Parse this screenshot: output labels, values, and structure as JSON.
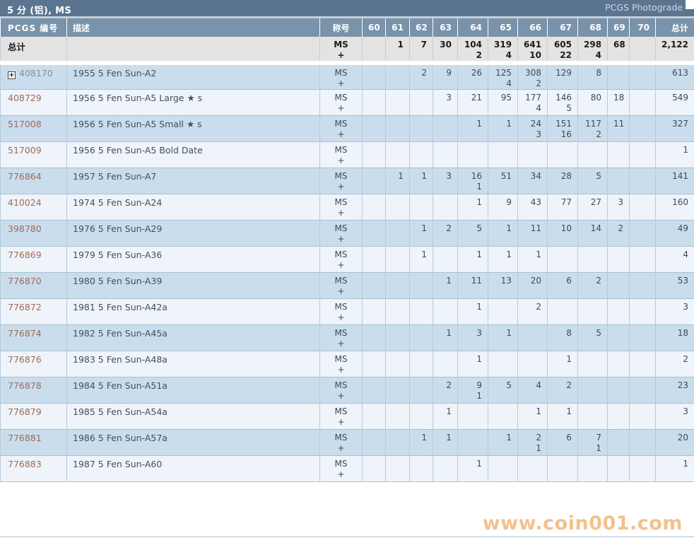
{
  "header": {
    "title": "5 分 (铝), MS",
    "photograde_link": "PCGS Photograde"
  },
  "icons": {
    "expand_glyph": "+"
  },
  "watermark": "www.coin001.com",
  "colors": {
    "title_bar": "#5b7490",
    "header_row": "#7893aa",
    "row_blue": "#cadded",
    "row_pale": "#eef4f9",
    "totals_bg": "#e3e3e3",
    "link": "#9c6a59",
    "visited_link": "#8d8d8d",
    "watermark": "#f2a960"
  },
  "table": {
    "columns": [
      "PCGS 编号",
      "描述",
      "称号",
      "60",
      "61",
      "62",
      "63",
      "64",
      "65",
      "66",
      "67",
      "68",
      "69",
      "70",
      "总计"
    ],
    "designation": {
      "line1": "MS",
      "line2": "+"
    },
    "totals": {
      "label": "总计",
      "grades": [
        [
          "",
          ""
        ],
        [
          "1",
          ""
        ],
        [
          "7",
          ""
        ],
        [
          "30",
          ""
        ],
        [
          "104",
          "2"
        ],
        [
          "319",
          "4"
        ],
        [
          "641",
          "10"
        ],
        [
          "605",
          "22"
        ],
        [
          "298",
          "4"
        ],
        [
          "68",
          ""
        ],
        [
          "",
          ""
        ]
      ],
      "total": "2,122"
    },
    "rows": [
      {
        "pcgs": "408170",
        "expandable": true,
        "visited": true,
        "desc": "1955 5 Fen Sun-A2",
        "grades": [
          [
            "",
            ""
          ],
          [
            "",
            ""
          ],
          [
            "2",
            ""
          ],
          [
            "9",
            ""
          ],
          [
            "26",
            ""
          ],
          [
            "125",
            "4"
          ],
          [
            "308",
            "2"
          ],
          [
            "129",
            ""
          ],
          [
            "8",
            ""
          ],
          [
            "",
            ""
          ],
          [
            "",
            ""
          ]
        ],
        "total": "613"
      },
      {
        "pcgs": "408729",
        "desc": "1956 5 Fen Sun-A5 Large ★ s",
        "grades": [
          [
            "",
            ""
          ],
          [
            "",
            ""
          ],
          [
            "",
            ""
          ],
          [
            "3",
            ""
          ],
          [
            "21",
            ""
          ],
          [
            "95",
            ""
          ],
          [
            "177",
            "4"
          ],
          [
            "146",
            "5"
          ],
          [
            "80",
            ""
          ],
          [
            "18",
            ""
          ],
          [
            "",
            ""
          ]
        ],
        "total": "549"
      },
      {
        "pcgs": "517008",
        "desc": "1956 5 Fen Sun-A5 Small ★ s",
        "grades": [
          [
            "",
            ""
          ],
          [
            "",
            ""
          ],
          [
            "",
            ""
          ],
          [
            "",
            ""
          ],
          [
            "1",
            ""
          ],
          [
            "1",
            ""
          ],
          [
            "24",
            "3"
          ],
          [
            "151",
            "16"
          ],
          [
            "117",
            "2"
          ],
          [
            "11",
            ""
          ],
          [
            "",
            ""
          ]
        ],
        "total": "327"
      },
      {
        "pcgs": "517009",
        "desc": "1956 5 Fen Sun-A5 Bold Date",
        "grades": [
          [
            "",
            ""
          ],
          [
            "",
            ""
          ],
          [
            "",
            ""
          ],
          [
            "",
            ""
          ],
          [
            "",
            ""
          ],
          [
            "",
            ""
          ],
          [
            "",
            ""
          ],
          [
            "",
            ""
          ],
          [
            "",
            ""
          ],
          [
            "",
            ""
          ],
          [
            "",
            ""
          ]
        ],
        "total": "1"
      },
      {
        "pcgs": "776864",
        "desc": "1957 5 Fen Sun-A7",
        "grades": [
          [
            "",
            ""
          ],
          [
            "1",
            ""
          ],
          [
            "1",
            ""
          ],
          [
            "3",
            ""
          ],
          [
            "16",
            "1"
          ],
          [
            "51",
            ""
          ],
          [
            "34",
            ""
          ],
          [
            "28",
            ""
          ],
          [
            "5",
            ""
          ],
          [
            "",
            ""
          ],
          [
            "",
            ""
          ]
        ],
        "total": "141"
      },
      {
        "pcgs": "410024",
        "desc": "1974 5 Fen Sun-A24",
        "grades": [
          [
            "",
            ""
          ],
          [
            "",
            ""
          ],
          [
            "",
            ""
          ],
          [
            "",
            ""
          ],
          [
            "1",
            ""
          ],
          [
            "9",
            ""
          ],
          [
            "43",
            ""
          ],
          [
            "77",
            ""
          ],
          [
            "27",
            ""
          ],
          [
            "3",
            ""
          ],
          [
            "",
            ""
          ]
        ],
        "total": "160"
      },
      {
        "pcgs": "398780",
        "desc": "1976 5 Fen Sun-A29",
        "grades": [
          [
            "",
            ""
          ],
          [
            "",
            ""
          ],
          [
            "1",
            ""
          ],
          [
            "2",
            ""
          ],
          [
            "5",
            ""
          ],
          [
            "1",
            ""
          ],
          [
            "11",
            ""
          ],
          [
            "10",
            ""
          ],
          [
            "14",
            ""
          ],
          [
            "2",
            ""
          ],
          [
            "",
            ""
          ]
        ],
        "total": "49"
      },
      {
        "pcgs": "776869",
        "desc": "1979 5 Fen Sun-A36",
        "grades": [
          [
            "",
            ""
          ],
          [
            "",
            ""
          ],
          [
            "1",
            ""
          ],
          [
            "",
            ""
          ],
          [
            "1",
            ""
          ],
          [
            "1",
            ""
          ],
          [
            "1",
            ""
          ],
          [
            "",
            ""
          ],
          [
            "",
            ""
          ],
          [
            "",
            ""
          ],
          [
            "",
            ""
          ]
        ],
        "total": "4"
      },
      {
        "pcgs": "776870",
        "desc": "1980 5 Fen Sun-A39",
        "grades": [
          [
            "",
            ""
          ],
          [
            "",
            ""
          ],
          [
            "",
            ""
          ],
          [
            "1",
            ""
          ],
          [
            "11",
            ""
          ],
          [
            "13",
            ""
          ],
          [
            "20",
            ""
          ],
          [
            "6",
            ""
          ],
          [
            "2",
            ""
          ],
          [
            "",
            ""
          ],
          [
            "",
            ""
          ]
        ],
        "total": "53"
      },
      {
        "pcgs": "776872",
        "desc": "1981 5 Fen Sun-A42a",
        "grades": [
          [
            "",
            ""
          ],
          [
            "",
            ""
          ],
          [
            "",
            ""
          ],
          [
            "",
            ""
          ],
          [
            "1",
            ""
          ],
          [
            "",
            ""
          ],
          [
            "2",
            ""
          ],
          [
            "",
            ""
          ],
          [
            "",
            ""
          ],
          [
            "",
            ""
          ],
          [
            "",
            ""
          ]
        ],
        "total": "3"
      },
      {
        "pcgs": "776874",
        "desc": "1982 5 Fen Sun-A45a",
        "grades": [
          [
            "",
            ""
          ],
          [
            "",
            ""
          ],
          [
            "",
            ""
          ],
          [
            "1",
            ""
          ],
          [
            "3",
            ""
          ],
          [
            "1",
            ""
          ],
          [
            "",
            ""
          ],
          [
            "8",
            ""
          ],
          [
            "5",
            ""
          ],
          [
            "",
            ""
          ],
          [
            "",
            ""
          ]
        ],
        "total": "18"
      },
      {
        "pcgs": "776876",
        "desc": "1983 5 Fen Sun-A48a",
        "grades": [
          [
            "",
            ""
          ],
          [
            "",
            ""
          ],
          [
            "",
            ""
          ],
          [
            "",
            ""
          ],
          [
            "1",
            ""
          ],
          [
            "",
            ""
          ],
          [
            "",
            ""
          ],
          [
            "1",
            ""
          ],
          [
            "",
            ""
          ],
          [
            "",
            ""
          ],
          [
            "",
            ""
          ]
        ],
        "total": "2"
      },
      {
        "pcgs": "776878",
        "desc": "1984 5 Fen Sun-A51a",
        "grades": [
          [
            "",
            ""
          ],
          [
            "",
            ""
          ],
          [
            "",
            ""
          ],
          [
            "2",
            ""
          ],
          [
            "9",
            "1"
          ],
          [
            "5",
            ""
          ],
          [
            "4",
            ""
          ],
          [
            "2",
            ""
          ],
          [
            "",
            ""
          ],
          [
            "",
            ""
          ],
          [
            "",
            ""
          ]
        ],
        "total": "23"
      },
      {
        "pcgs": "776879",
        "desc": "1985 5 Fen Sun-A54a",
        "grades": [
          [
            "",
            ""
          ],
          [
            "",
            ""
          ],
          [
            "",
            ""
          ],
          [
            "1",
            ""
          ],
          [
            "",
            ""
          ],
          [
            "",
            ""
          ],
          [
            "1",
            ""
          ],
          [
            "1",
            ""
          ],
          [
            "",
            ""
          ],
          [
            "",
            ""
          ],
          [
            "",
            ""
          ]
        ],
        "total": "3"
      },
      {
        "pcgs": "776881",
        "desc": "1986 5 Fen Sun-A57a",
        "grades": [
          [
            "",
            ""
          ],
          [
            "",
            ""
          ],
          [
            "1",
            ""
          ],
          [
            "1",
            ""
          ],
          [
            "",
            ""
          ],
          [
            "1",
            ""
          ],
          [
            "2",
            "1"
          ],
          [
            "6",
            ""
          ],
          [
            "7",
            "1"
          ],
          [
            "",
            ""
          ],
          [
            "",
            ""
          ]
        ],
        "total": "20"
      },
      {
        "pcgs": "776883",
        "desc": "1987 5 Fen Sun-A60",
        "grades": [
          [
            "",
            ""
          ],
          [
            "",
            ""
          ],
          [
            "",
            ""
          ],
          [
            "",
            ""
          ],
          [
            "1",
            ""
          ],
          [
            "",
            ""
          ],
          [
            "",
            ""
          ],
          [
            "",
            ""
          ],
          [
            "",
            ""
          ],
          [
            "",
            ""
          ],
          [
            "",
            ""
          ]
        ],
        "total": "1"
      }
    ]
  }
}
